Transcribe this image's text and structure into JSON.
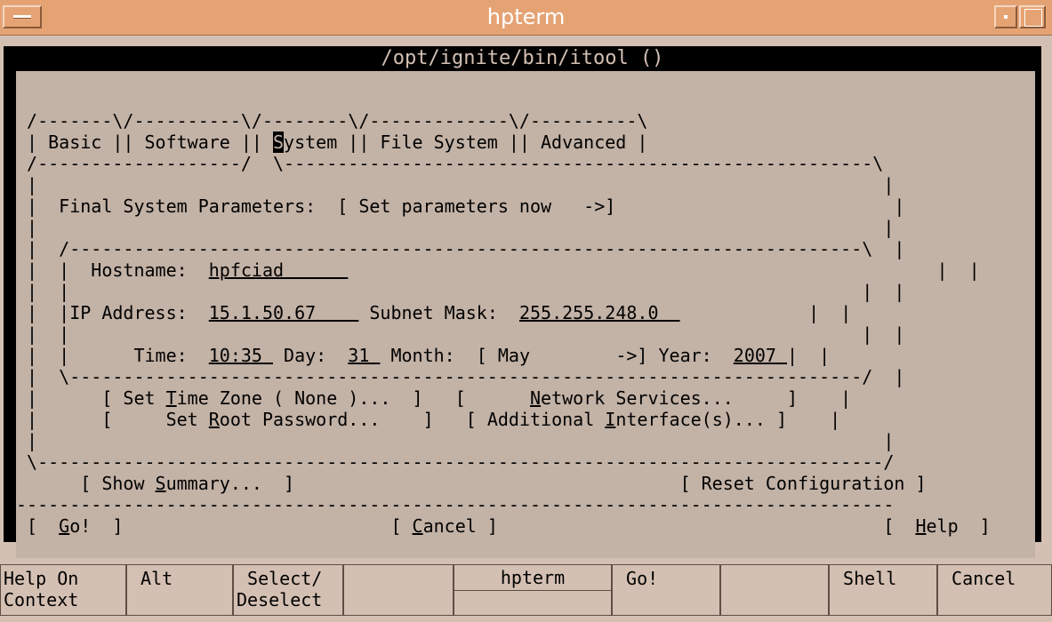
{
  "window": {
    "title": "hpterm"
  },
  "terminal": {
    "title": "/opt/ignite/bin/itool ()",
    "lines": [
      " /-------\\/----------\\/--------\\/-------------\\/----------\\",
      " | Basic || Software || ",
      "ystem || File System || Advanced |",
      " /-------------------/  \\-------------------------------------------------------\\",
      " |                                                                               |",
      " |  Final System Parameters:  [ Set parameters now   ->]                          |",
      " |                                                                               |",
      " |  /--------------------------------------------------------------------------\\  |",
      " |  |  Hostname:  ",
      "hpfciad      ",
      "                                                       |  |",
      " |  |                                                                          |  |",
      " |  |IP Address:  ",
      "15.1.50.67    ",
      " Subnet Mask:  ",
      "255.255.248.0  ",
      "            |  |",
      " |  |                                                                          |  |",
      " |  |      Time:  ",
      "10:35 ",
      " Day:  ",
      "31 ",
      " Month:  [ May        ->] Year:  ",
      "2007 ",
      "|  |",
      " |  \\--------------------------------------------------------------------------/  |",
      " |      [ Set ",
      "ime Zone ( None )...  ]   [      ",
      "etwork Services...     ]    |",
      " |      [     Set ",
      "oot Password...    ]   [ Additional ",
      "nterface(s)... ]    |",
      " |                                                                               |",
      " \\-------------------------------------------------------------------------------/",
      "      [ Show ",
      "ummary...  ]                                    [ Reset Configuration ]",
      "----------------------------------------------------------------------------------",
      " [  ",
      "o!  ]                         [ ",
      "ancel ]                                    [  ",
      "elp  ]"
    ],
    "hotkeys": {
      "S": "S",
      "T": "T",
      "N": "N",
      "R": "R",
      "I": "I",
      "Sum": "S",
      "G": "G",
      "C": "C",
      "H": "H"
    }
  },
  "softkeys": [
    {
      "line1": "Help On",
      "line2": "Context"
    },
    {
      "line1": " Alt",
      "line2": ""
    },
    {
      "line1": " Select/",
      "line2": "Deselect"
    },
    {
      "line1": "",
      "line2": ""
    },
    {
      "line1": "hpterm",
      "line2": ""
    },
    {
      "line1": " Go!",
      "line2": ""
    },
    {
      "line1": "",
      "line2": ""
    },
    {
      "line1": " Shell",
      "line2": ""
    },
    {
      "line1": " Cancel",
      "line2": ""
    }
  ]
}
